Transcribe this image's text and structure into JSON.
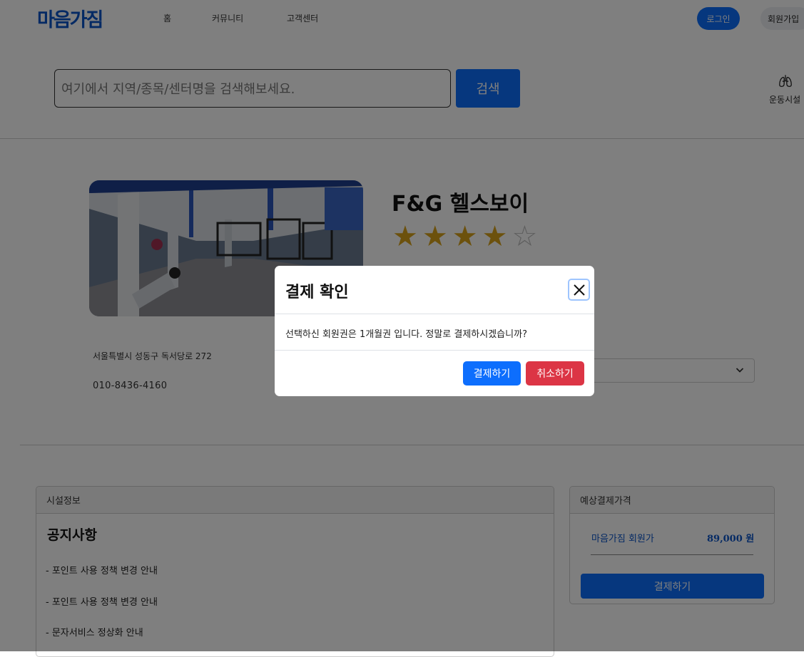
{
  "header": {
    "logo": "마음가짐",
    "nav": [
      "홈",
      "커뮤니티",
      "고객센터"
    ],
    "login_label": "로그인",
    "signup_label": "회원가입"
  },
  "search": {
    "placeholder": "여기에서 지역/종목/센터명을 검색해보세요.",
    "button_label": "검색"
  },
  "category": {
    "label": "운동시설",
    "icon": "lungs-icon"
  },
  "facility": {
    "name": "F&G 헬스보이",
    "rating": 4,
    "rating_max": 5,
    "address": "서울특별시 성동구 독서당로 272",
    "phone": "010-8436-4160"
  },
  "info_card": {
    "header": "시설정보",
    "title": "공지사항",
    "notices": [
      "- 포인트 사용 정책 변경 안내",
      "- 포인트 사용 정책 변경 안내",
      "- 문자서비스 정상화 안내"
    ]
  },
  "price_card": {
    "header": "예상결제가격",
    "label": "마음가짐 회원가",
    "value": "89,000 원",
    "pay_label": "결제하기"
  },
  "modal": {
    "title": "결제 확인",
    "body": "선택하신 회원권은 1개월권 입니다. 정말로 결제하시겠습니까?",
    "confirm_label": "결제하기",
    "cancel_label": "취소하기"
  },
  "colors": {
    "primary": "#0d6efd",
    "logo": "#0b55c9",
    "danger": "#dc3545",
    "star": "#d8a31a"
  }
}
